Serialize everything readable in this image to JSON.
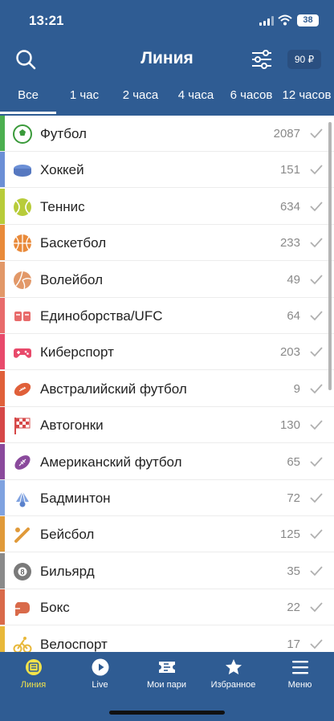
{
  "status_bar": {
    "time": "13:21",
    "battery": "38"
  },
  "header": {
    "title": "Линия",
    "balance": "90 ₽"
  },
  "period_tabs": [
    {
      "label": "Все",
      "active": true
    },
    {
      "label": "1 час"
    },
    {
      "label": "2 часа"
    },
    {
      "label": "4 часа"
    },
    {
      "label": "6 часов"
    },
    {
      "label": "12 часов"
    }
  ],
  "sports": [
    {
      "name": "Футбол",
      "count": "2087",
      "color": "#4caf50",
      "icon": "soccer-ball-icon"
    },
    {
      "name": "Хоккей",
      "count": "151",
      "color": "#6b8fd6",
      "icon": "hockey-puck-icon"
    },
    {
      "name": "Теннис",
      "count": "634",
      "color": "#b8cc3a",
      "icon": "tennis-ball-icon"
    },
    {
      "name": "Баскетбол",
      "count": "233",
      "color": "#e98a3a",
      "icon": "basketball-icon"
    },
    {
      "name": "Волейбол",
      "count": "49",
      "color": "#e29868",
      "icon": "volleyball-icon"
    },
    {
      "name": "Единоборства/UFC",
      "count": "64",
      "color": "#e86b6b",
      "icon": "martial-arts-icon"
    },
    {
      "name": "Киберспорт",
      "count": "203",
      "color": "#e84a6b",
      "icon": "gamepad-icon"
    },
    {
      "name": "Австралийский футбол",
      "count": "9",
      "color": "#e0603a",
      "icon": "australian-football-icon"
    },
    {
      "name": "Автогонки",
      "count": "130",
      "color": "#d64848",
      "icon": "racing-flag-icon"
    },
    {
      "name": "Американский футбол",
      "count": "65",
      "color": "#8a4a9c",
      "icon": "american-football-icon"
    },
    {
      "name": "Бадминтон",
      "count": "72",
      "color": "#7fa2e0",
      "icon": "shuttlecock-icon"
    },
    {
      "name": "Бейсбол",
      "count": "125",
      "color": "#e09a3a",
      "icon": "baseball-bat-icon"
    },
    {
      "name": "Бильярд",
      "count": "35",
      "color": "#8a8a8a",
      "icon": "billiard-ball-icon"
    },
    {
      "name": "Бокс",
      "count": "22",
      "color": "#d96a4a",
      "icon": "boxing-glove-icon"
    },
    {
      "name": "Велоспорт",
      "count": "17",
      "color": "#e8b83a",
      "icon": "cyclist-icon"
    }
  ],
  "tabbar": [
    {
      "label": "Линия",
      "icon": "ticket-list-icon",
      "active": true
    },
    {
      "label": "Live",
      "icon": "play-icon"
    },
    {
      "label": "Мои пари",
      "icon": "bets-ticket-icon"
    },
    {
      "label": "Избранное",
      "icon": "star-icon"
    },
    {
      "label": "Меню",
      "icon": "menu-icon"
    }
  ],
  "colors": {
    "primary": "#2f5c93",
    "active_tab": "#f2e34a"
  }
}
